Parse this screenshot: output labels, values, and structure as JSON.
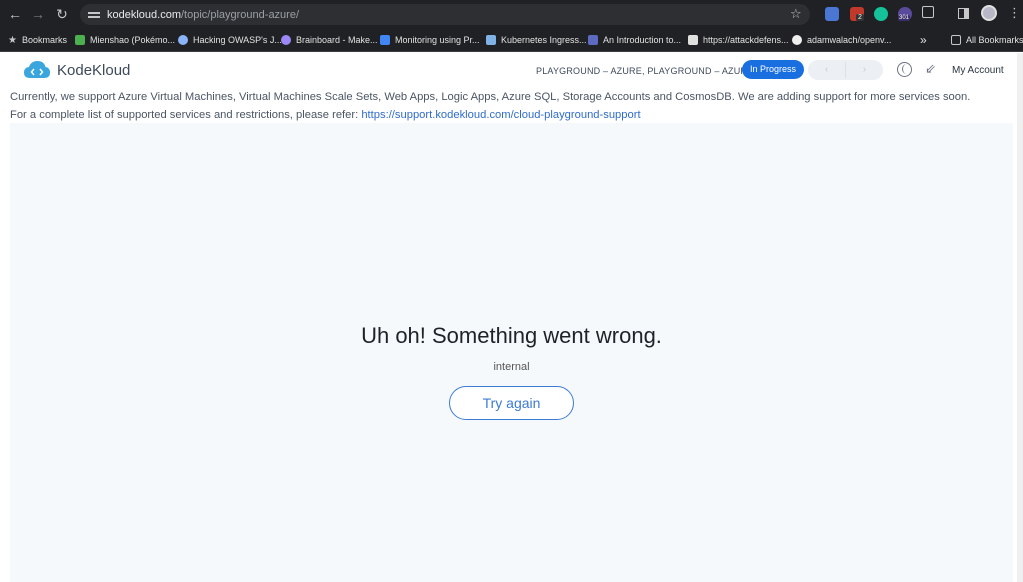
{
  "browser": {
    "url_host": "kodekloud.com",
    "url_path": "/topic/playground-azure/",
    "bookmarks": [
      "Bookmarks",
      "Mienshao (Pokémo...",
      "Hacking OWASP's J...",
      "Brainboard - Make...",
      "Monitoring using Pr...",
      "Kubernetes Ingress...",
      "An Introduction to...",
      "https://attackdefens...",
      "adamwalach/openv...",
      "All Bookmarks"
    ],
    "more_label": "»",
    "ext_badges": [
      "2",
      "301"
    ]
  },
  "header": {
    "logo_text": "KodeKloud",
    "breadcrumb": "PLAYGROUND – AZURE, PLAYGROUND – AZURE",
    "status": "In Progress",
    "account": "My Account"
  },
  "notice": {
    "line1": "Currently,  we support Azure Virtual Machines, Virtual Machines Scale Sets, Web Apps, Logic Apps,  Azure SQL, Storage Accounts and CosmosDB. We are adding support for more services soon.",
    "line2_prefix": "For a complete list of supported services and restrictions, please refer: ",
    "link": "https://support.kodekloud.com/cloud-playground-support"
  },
  "error": {
    "title": "Uh oh! Something went wrong.",
    "detail": "internal",
    "retry_label": "Try again"
  },
  "colors": {
    "accent": "#1a6fe0",
    "link": "#2f6cc9",
    "panel_bg": "#f6f9fc"
  }
}
